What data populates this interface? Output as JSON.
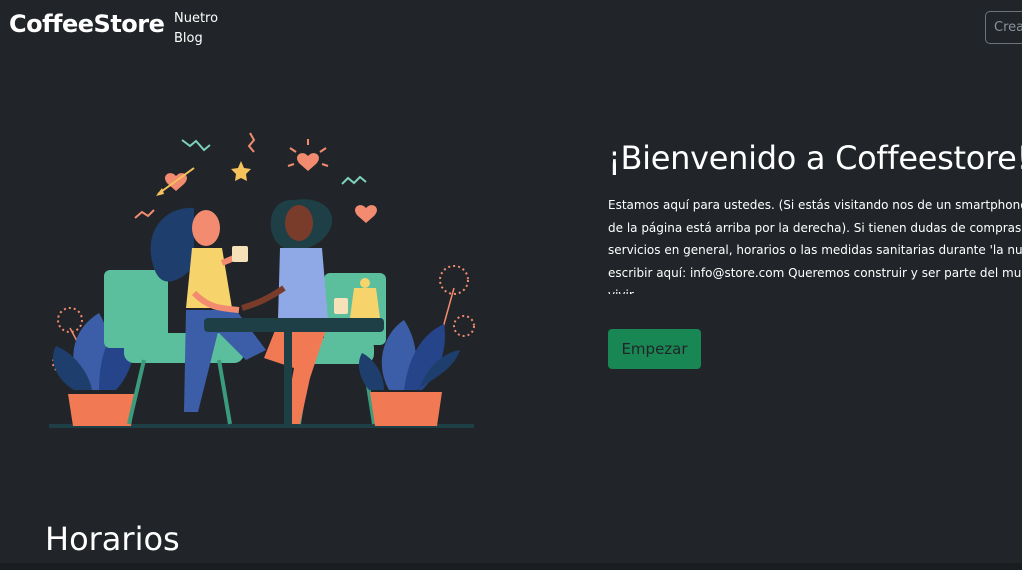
{
  "navbar": {
    "brand": "CoffeeStore",
    "blog_link": "Nuetro Blog",
    "search_placeholder": "Crear"
  },
  "hero": {
    "title": "¡Bienvenido a Coffeestore!",
    "paragraph_lines": [
      "Estamos aquí para ustedes. (Si estás visitando nos de un smartphone, el menú",
      "de la página está arriba por la derecha). Si tienen dudas de compras o los",
      "servicios en general, horarios o las medidas sanitarias durante 'la nueva',",
      "escribir aquí: info@store.com Queremos construir y ser parte del mundo que",
      "vivir."
    ],
    "button_label": "Empezar"
  },
  "schedule": {
    "title": "Horarios"
  },
  "illustration": {
    "icon": "friends-having-coffee-illustration"
  },
  "colors": {
    "background": "#212529",
    "button": "#198754",
    "text": "#ffffff"
  }
}
